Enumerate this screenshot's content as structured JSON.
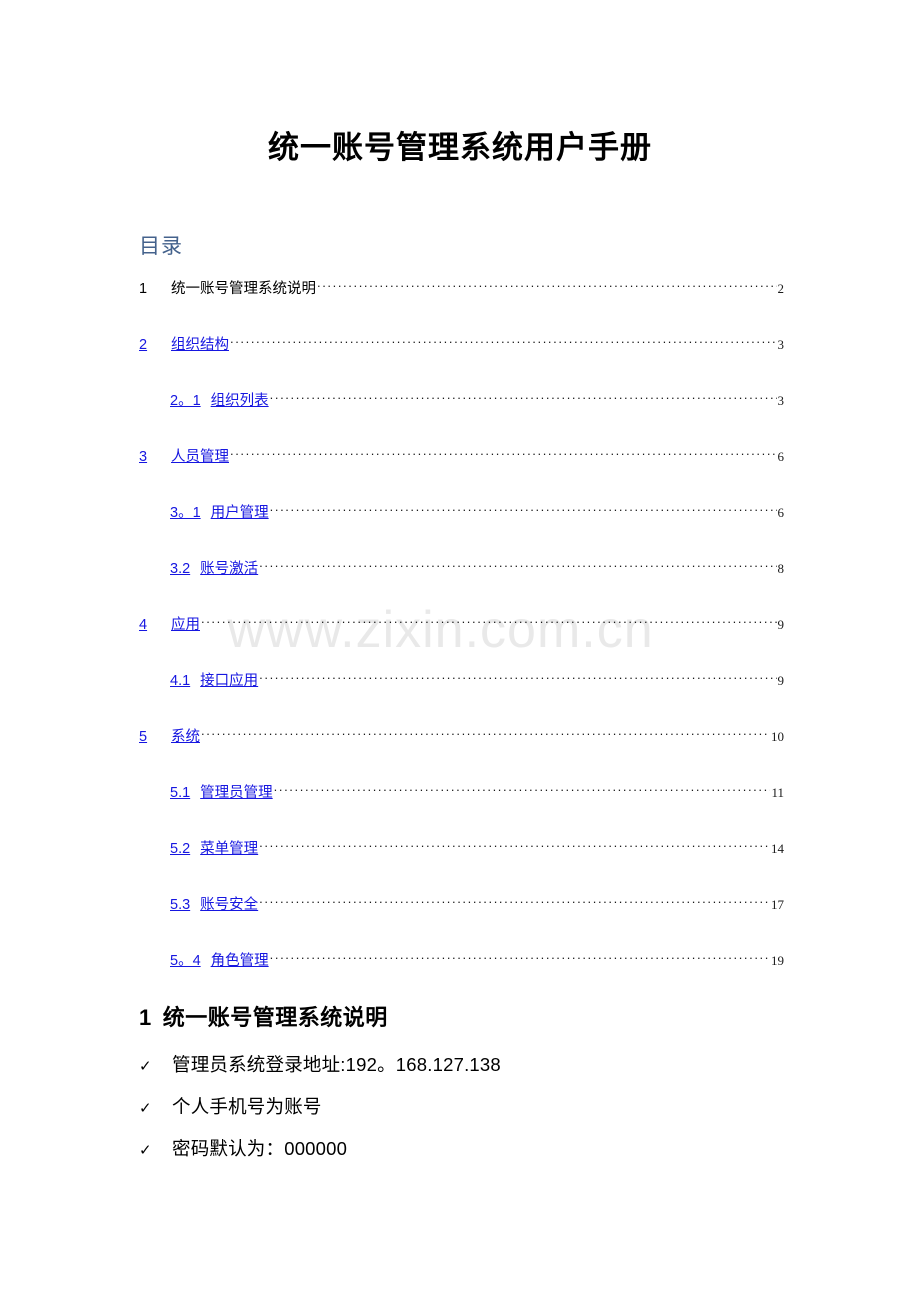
{
  "document": {
    "title": "统一账号管理系统用户手册",
    "watermark": "www.zixin.com.cn"
  },
  "toc": {
    "heading": "目录",
    "entries": [
      {
        "level": 1,
        "number": "1",
        "title": "统一账号管理系统说明",
        "page": "2",
        "link": false
      },
      {
        "level": 1,
        "number": "2",
        "title": "组织结构",
        "page": "3",
        "link": true
      },
      {
        "level": 2,
        "number": "2。1",
        "title": "组织列表",
        "page": "3",
        "link": true
      },
      {
        "level": 1,
        "number": "3",
        "title": "人员管理",
        "page": "6",
        "link": true
      },
      {
        "level": 2,
        "number": "3。1",
        "title": "用户管理",
        "page": "6",
        "link": true
      },
      {
        "level": 2,
        "number": "3.2",
        "title": "账号激活",
        "page": "8",
        "link": true
      },
      {
        "level": 1,
        "number": "4",
        "title": "应用",
        "page": "9",
        "link": true
      },
      {
        "level": 2,
        "number": "4.1",
        "title": "接口应用",
        "page": "9",
        "link": true
      },
      {
        "level": 1,
        "number": "5",
        "title": "系统",
        "page": "10",
        "link": true
      },
      {
        "level": 2,
        "number": "5.1",
        "title": "管理员管理",
        "page": "11",
        "link": true
      },
      {
        "level": 2,
        "number": "5.2",
        "title": "菜单管理",
        "page": "14",
        "link": true
      },
      {
        "level": 2,
        "number": "5.3",
        "title": "账号安全",
        "page": "17",
        "link": true
      },
      {
        "level": 2,
        "number": "5。4",
        "title": "角色管理",
        "page": "19",
        "link": true
      }
    ]
  },
  "section1": {
    "number": "1",
    "title": "统一账号管理系统说明",
    "bullet_marker": "✓",
    "bullets": [
      "管理员系统登录地址:192。168.127.138",
      "个人手机号为账号",
      "密码默认为：000000"
    ]
  },
  "colors": {
    "link": "#1616e0",
    "toc_heading": "#44628c",
    "text": "#000000",
    "watermark": "#e9e9e9"
  }
}
